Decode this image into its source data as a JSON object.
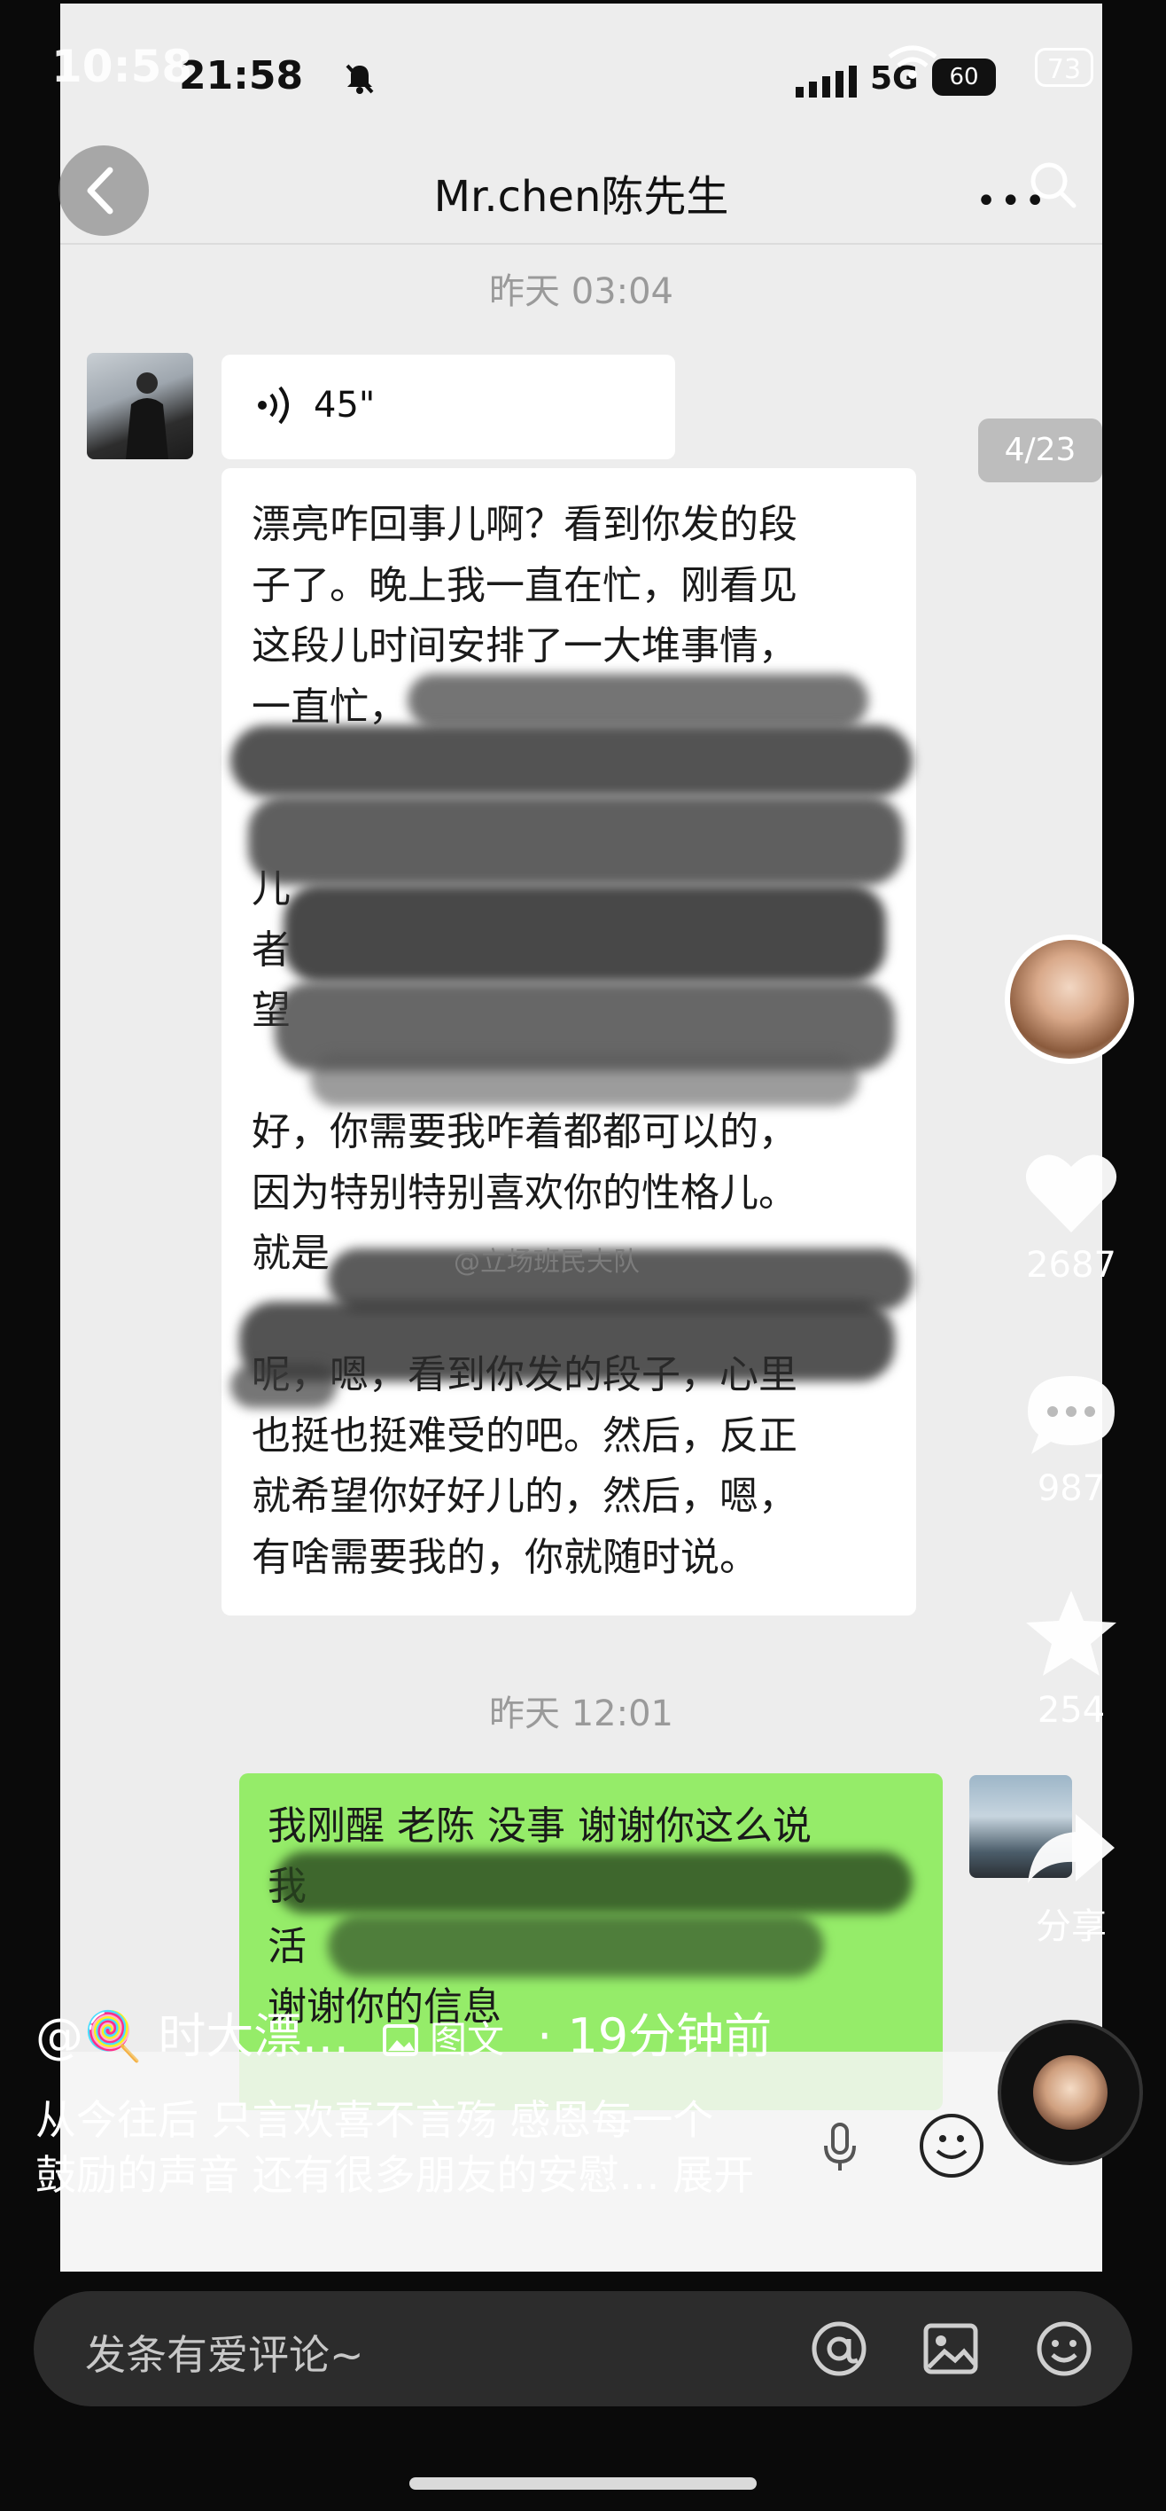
{
  "outer_status": {
    "time": "10:58",
    "battery": "73"
  },
  "shot": {
    "status": {
      "time": "21:58",
      "network": "5G",
      "battery": "60"
    },
    "chat_title": "Mr.chen陈先生",
    "timestamp_1": "昨天 03:04",
    "voice_duration": "45\"",
    "message_lines": [
      "漂亮咋回事儿啊？看到你发的段",
      "子了。晚上我一直在忙，刚看见",
      "这段儿时间安排了一大堆事情，",
      "一直忙，",
      "",
      "",
      "儿",
      "者",
      "望",
      "",
      "好，你需要我咋着都都可以的，",
      "因为特别特别喜欢你的性格儿。",
      "就是",
      "",
      "呢，嗯，看到你发的段子，心里",
      "也挺也挺难受的吧。然后，反正",
      "就希望你好好儿的，然后，嗯，",
      "有啥需要我的，你就随时说。"
    ],
    "watermark": "@立场班民夫队",
    "timestamp_2": "昨天 12:01",
    "reply_lines": [
      "我刚醒 老陈 没事 谢谢你这么说",
      "我",
      "活",
      "谢谢你的信息"
    ]
  },
  "overlay": {
    "counter": "4/23",
    "like_count": "2687",
    "comment_count": "987",
    "favorite_count": "254",
    "share_label": "分享",
    "author": "@🍭 时大漂…",
    "post_tag": "图文",
    "posted_ago": "· 19分钟前",
    "caption_lines": [
      "从今往后 只言欢喜不言殇 感恩每一个",
      "鼓励的声音 还有很多朋友的安慰… 展开"
    ],
    "comment_placeholder": "发条有爱评论~"
  },
  "icons": [
    "back-icon",
    "search-icon",
    "more-icon",
    "voice-wave-icon",
    "mic-icon",
    "emoji-icon",
    "heart-icon",
    "comment-icon",
    "star-icon",
    "share-icon",
    "at-icon",
    "image-icon",
    "picture-tag-icon"
  ]
}
